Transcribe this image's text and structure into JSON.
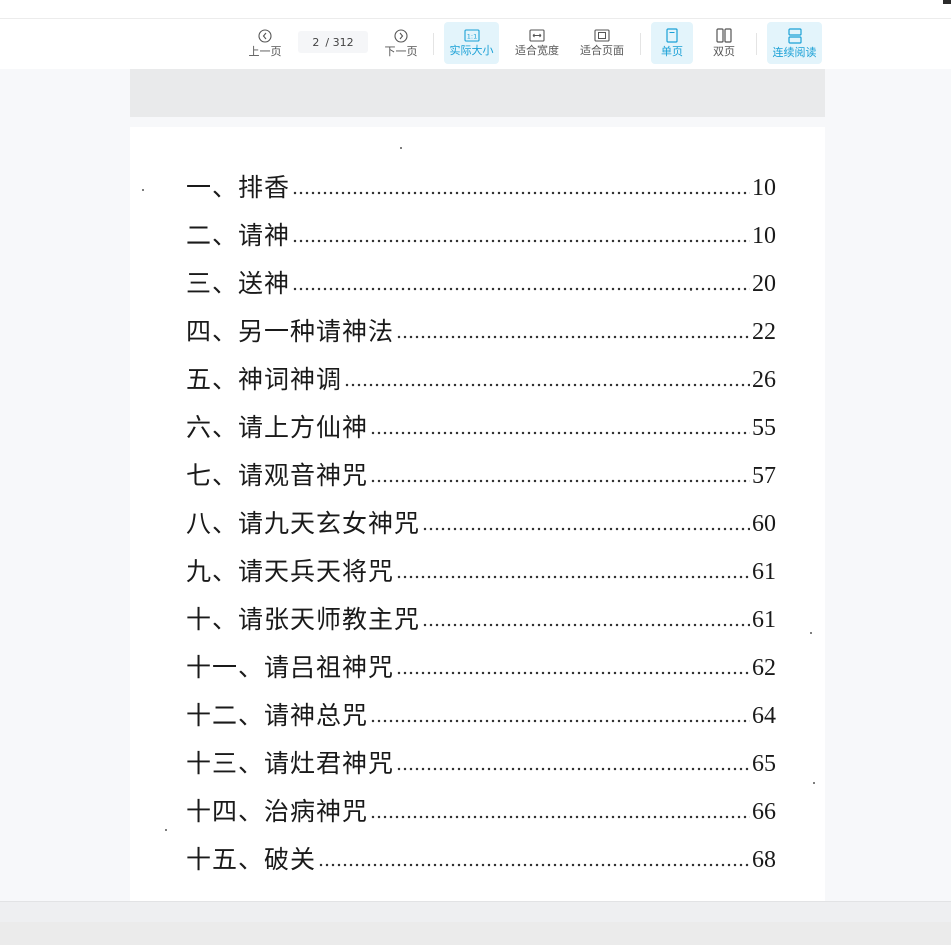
{
  "toolbar": {
    "prev_label": "上一页",
    "next_label": "下一页",
    "current_page": "2",
    "total_pages": "/ 312",
    "actual_size_label": "实际大小",
    "fit_width_label": "适合宽度",
    "fit_page_label": "适合页面",
    "single_page_label": "单页",
    "double_page_label": "双页",
    "continuous_label": "连续阅读",
    "accent_color": "#1aa0d6"
  },
  "toc": [
    {
      "title": "一、排香",
      "page": "10"
    },
    {
      "title": "二、请神",
      "page": "10"
    },
    {
      "title": "三、送神",
      "page": "20"
    },
    {
      "title": "四、另一种请神法",
      "page": "22"
    },
    {
      "title": "五、神词神调",
      "page": "26"
    },
    {
      "title": "六、请上方仙神",
      "page": "55"
    },
    {
      "title": "七、请观音神咒",
      "page": "57"
    },
    {
      "title": "八、请九天玄女神咒",
      "page": "60"
    },
    {
      "title": "九、请天兵天将咒",
      "page": "61"
    },
    {
      "title": "十、请张天师教主咒",
      "page": "61"
    },
    {
      "title": "十一、请吕祖神咒",
      "page": "62"
    },
    {
      "title": "十二、请神总咒",
      "page": "64"
    },
    {
      "title": "十三、请灶君神咒",
      "page": "65"
    },
    {
      "title": "十四、治病神咒",
      "page": "66"
    },
    {
      "title": "十五、破关",
      "page": "68"
    }
  ]
}
